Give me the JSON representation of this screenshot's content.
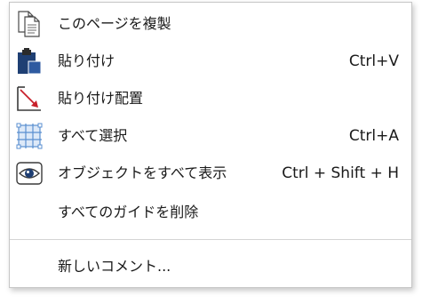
{
  "menu": {
    "items": [
      {
        "label": "このページを複製",
        "shortcut": "",
        "icon": "duplicate-page-icon"
      },
      {
        "label": "貼り付け",
        "shortcut": "Ctrl+V",
        "icon": "paste-icon"
      },
      {
        "label": "貼り付け配置",
        "shortcut": "",
        "icon": "paste-in-place-icon"
      },
      {
        "label": "すべて選択",
        "shortcut": "Ctrl+A",
        "icon": "select-all-icon"
      },
      {
        "label": "オブジェクトをすべて表示",
        "shortcut": "Ctrl + Shift + H",
        "icon": "eye-icon"
      },
      {
        "label": "すべてのガイドを削除",
        "shortcut": ""
      },
      {
        "label": "新しいコメント...",
        "shortcut": ""
      }
    ]
  },
  "colors": {
    "paste_body": "#1f3f73",
    "paste_clip": "#2b2b2b",
    "arrow_red": "#c8202a",
    "grid_blue": "#5a8fd0",
    "icon_outline": "#3a3a3a",
    "divider": "#d4d4d4"
  }
}
